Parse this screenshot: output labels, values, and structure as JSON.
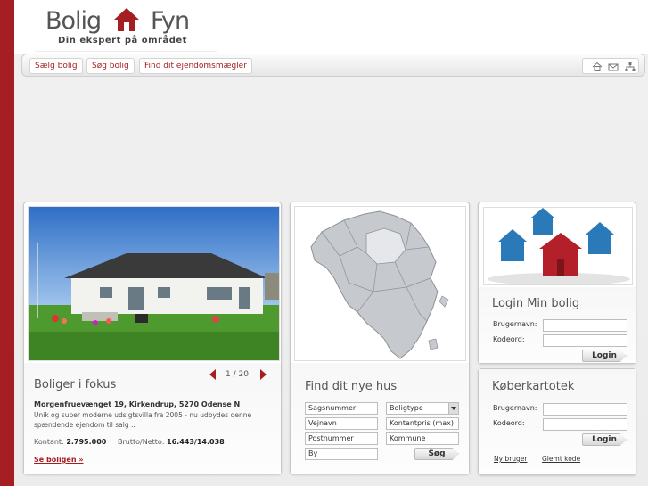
{
  "logo": {
    "word1": "Bolig",
    "word2": "Fyn",
    "tagline": "Din ekspert på området"
  },
  "nav": {
    "items": [
      {
        "label": "Sælg bolig"
      },
      {
        "label": "Søg bolig"
      },
      {
        "label": "Find dit ejendomsmægler"
      }
    ]
  },
  "toolbar": {
    "icons": [
      "home-icon",
      "mail-icon",
      "sitemap-icon"
    ]
  },
  "focus": {
    "title": "Boliger i fokus",
    "pager": "1 / 20",
    "address": "Morgenfruevænget 19, Kirkendrup, 5270 Odense N",
    "description": "Unik og super moderne udsigtsvilla fra 2005 - nu udbydes denne spændende ejendom til salg ..",
    "cash_label": "Kontant:",
    "cash_value": "2.795.000",
    "net_label": "Brutto/Netto:",
    "net_value": "16.443/14.038",
    "link": "Se boligen »"
  },
  "search": {
    "title": "Find dit nye hus",
    "case_placeholder": "Sagsnummer",
    "type_label": "Boligtype",
    "street_placeholder": "Vejnavn",
    "price_placeholder": "Kontantpris (max)",
    "zip_placeholder": "Postnummer",
    "municipality_placeholder": "Kommune",
    "city_placeholder": "By",
    "button": "Søg"
  },
  "login": {
    "title": "Login Min bolig",
    "user_label": "Brugernavn:",
    "pass_label": "Kodeord:",
    "button": "Login"
  },
  "buyer": {
    "title": "Køberkartotek",
    "user_label": "Brugernavn:",
    "pass_label": "Kodeord:",
    "button": "Login",
    "new_user": "Ny bruger",
    "forgot": "Glemt kode"
  },
  "colors": {
    "brand": "#a51e22",
    "house_blue": "#2a79b8",
    "house_red": "#b3202a"
  }
}
